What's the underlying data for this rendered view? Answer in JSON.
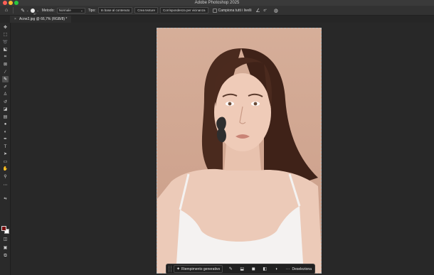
{
  "app": {
    "title": "Adobe Photoshop 2025"
  },
  "options_bar": {
    "brush_size": "37",
    "mode_label": "Metodo:",
    "mode_value": "Normale",
    "type_label": "Tipo:",
    "type_options": [
      "In base al contenuto",
      "Crea texture",
      "Corrispondenza per vicinanza"
    ],
    "sample_all_label": "Campiona tutti i livelli",
    "angle_value": "0°"
  },
  "document": {
    "tab_label": "Acne2.jpg @ 66,7% (RGB/8) *",
    "tab_close": "×"
  },
  "taskbar": {
    "generate_label": "Riempimento generativo",
    "deselect_label": "Deseleziona",
    "more_label": "···"
  },
  "colors": {
    "foreground": "#7a0e0e",
    "background": "#ffffff",
    "ui_dark": "#282828"
  }
}
